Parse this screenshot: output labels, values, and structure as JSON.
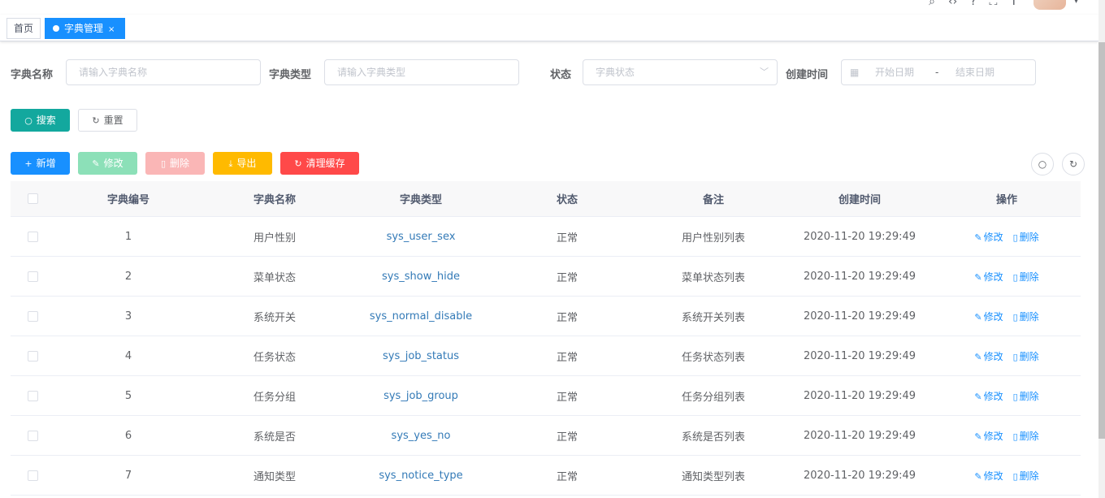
{
  "tags": {
    "home": "首页",
    "active": "字典管理",
    "close": "×"
  },
  "search": {
    "dict_name_label": "字典名称",
    "dict_name_placeholder": "请输入字典名称",
    "dict_type_label": "字典类型",
    "dict_type_placeholder": "请输入字典类型",
    "status_label": "状态",
    "status_placeholder": "字典状态",
    "created_label": "创建时间",
    "start_placeholder": "开始日期",
    "range_separator": "-",
    "end_placeholder": "结束日期",
    "search_button": "搜索",
    "reset_button": "重置"
  },
  "toolbar": {
    "add": "新增",
    "edit": "修改",
    "delete": "删除",
    "export": "导出",
    "clear_cache": "清理缓存"
  },
  "colors": {
    "primary": "#1890ff",
    "search": "#13a89e",
    "success_light": "#8ce0b8",
    "danger_light": "#fab6b6",
    "warning": "#ffba00",
    "danger": "#ff4949"
  },
  "table": {
    "headers": [
      "字典编号",
      "字典名称",
      "字典类型",
      "状态",
      "备注",
      "创建时间",
      "操作"
    ],
    "op_edit": "修改",
    "op_delete": "删除",
    "rows": [
      {
        "id": "1",
        "name": "用户性别",
        "type": "sys_user_sex",
        "status": "正常",
        "remark": "用户性别列表",
        "created": "2020-11-20 19:29:49"
      },
      {
        "id": "2",
        "name": "菜单状态",
        "type": "sys_show_hide",
        "status": "正常",
        "remark": "菜单状态列表",
        "created": "2020-11-20 19:29:49"
      },
      {
        "id": "3",
        "name": "系统开关",
        "type": "sys_normal_disable",
        "status": "正常",
        "remark": "系统开关列表",
        "created": "2020-11-20 19:29:49"
      },
      {
        "id": "4",
        "name": "任务状态",
        "type": "sys_job_status",
        "status": "正常",
        "remark": "任务状态列表",
        "created": "2020-11-20 19:29:49"
      },
      {
        "id": "5",
        "name": "任务分组",
        "type": "sys_job_group",
        "status": "正常",
        "remark": "任务分组列表",
        "created": "2020-11-20 19:29:49"
      },
      {
        "id": "6",
        "name": "系统是否",
        "type": "sys_yes_no",
        "status": "正常",
        "remark": "系统是否列表",
        "created": "2020-11-20 19:29:49"
      },
      {
        "id": "7",
        "name": "通知类型",
        "type": "sys_notice_type",
        "status": "正常",
        "remark": "通知类型列表",
        "created": "2020-11-20 19:29:49"
      }
    ]
  }
}
